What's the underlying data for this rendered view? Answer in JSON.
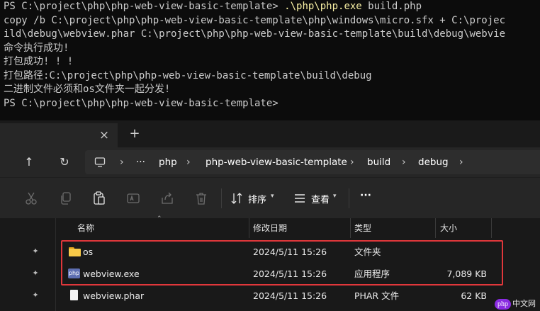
{
  "terminal": {
    "lines": [
      {
        "prompt": "PS C:\\project\\php\\php-web-view-basic-template> ",
        "cmd": ".\\php\\php.exe",
        "rest": " build.php"
      },
      {
        "text": "copy /b C:\\project\\php\\php-web-view-basic-template\\php\\windows\\micro.sfx + C:\\projec"
      },
      {
        "text": "ild\\debug\\webview.phar C:\\project\\php\\php-web-view-basic-template\\build\\debug\\webvie"
      },
      {
        "text": "命令执行成功!"
      },
      {
        "text": "打包成功! ! !"
      },
      {
        "text": "打包路径:C:\\project\\php\\php-web-view-basic-template\\build\\debug"
      },
      {
        "text": "二进制文件必须和os文件夹一起分发!"
      },
      {
        "text": "PS C:\\project\\php\\php-web-view-basic-template>"
      }
    ]
  },
  "tabs": {
    "close_glyph": "×",
    "add_glyph": "+"
  },
  "nav": {
    "up_glyph": "↑",
    "refresh_glyph": "↻",
    "breadcrumb": [
      "···",
      "php",
      "php-web-view-basic-template",
      "build",
      "debug"
    ],
    "sep_glyph": "›"
  },
  "toolbar": {
    "sort_label": "排序",
    "view_label": "查看",
    "more_glyph": "···"
  },
  "columns": {
    "name": "名称",
    "modified": "修改日期",
    "type": "类型",
    "size": "大小"
  },
  "files": [
    {
      "name": "os",
      "modified": "2024/5/11 15:26",
      "type": "文件夹",
      "size": "",
      "icon": "folder-icon"
    },
    {
      "name": "webview.exe",
      "modified": "2024/5/11 15:26",
      "type": "应用程序",
      "size": "7,089 KB",
      "icon": "php-exe-icon",
      "icon_text": "php"
    },
    {
      "name": "webview.phar",
      "modified": "2024/5/11 15:26",
      "type": "PHAR 文件",
      "size": "62 KB",
      "icon": "document-icon"
    }
  ],
  "watermark": {
    "logo": "php",
    "text": "中文网"
  },
  "colors": {
    "terminal_bg": "#0c0c0c",
    "command_yellow": "#f9f1a5",
    "highlight_red": "#e0373b",
    "folder_yellow": "#f7c948"
  }
}
